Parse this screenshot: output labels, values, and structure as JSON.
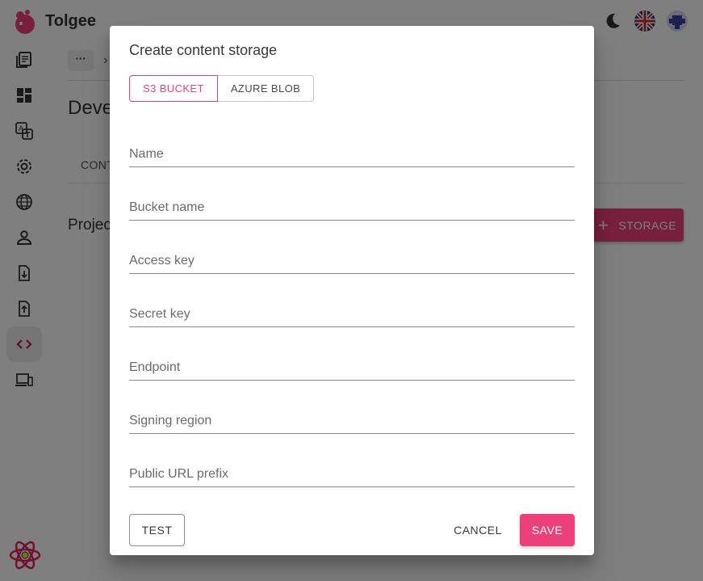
{
  "app": {
    "brand": "Tolgee"
  },
  "colors": {
    "accent": "#ec407a",
    "scrim": "rgba(0,0,0,0.5)"
  },
  "topbar": {
    "icons": [
      "theme-toggle-icon",
      "language-flag-icon",
      "user-avatar"
    ]
  },
  "sidebar": {
    "items": [
      {
        "icon": "projects-icon"
      },
      {
        "icon": "dashboard-icon"
      },
      {
        "icon": "translations-icon"
      },
      {
        "icon": "settings-icon"
      },
      {
        "icon": "languages-icon"
      },
      {
        "icon": "members-icon"
      },
      {
        "icon": "import-icon"
      },
      {
        "icon": "export-icon"
      },
      {
        "icon": "developer-icon",
        "active": true
      },
      {
        "icon": "integrate-icon"
      }
    ]
  },
  "background": {
    "breadcrumb_more": "···",
    "page_title": "Deve",
    "tab_label": "CONT",
    "section_heading": "Projec",
    "add_storage_label": "STORAGE"
  },
  "dialog": {
    "title": "Create content storage",
    "toggle": {
      "options": [
        "S3 BUCKET",
        "AZURE BLOB"
      ],
      "selected": "S3 BUCKET"
    },
    "fields": {
      "name": {
        "placeholder": "Name",
        "value": ""
      },
      "bucket_name": {
        "placeholder": "Bucket name",
        "value": ""
      },
      "access_key": {
        "placeholder": "Access key",
        "value": ""
      },
      "secret_key": {
        "placeholder": "Secret key",
        "value": ""
      },
      "endpoint": {
        "placeholder": "Endpoint",
        "value": ""
      },
      "signing_region": {
        "placeholder": "Signing region",
        "value": ""
      },
      "public_url_prefix": {
        "placeholder": "Public URL prefix",
        "value": ""
      }
    },
    "buttons": {
      "test": "TEST",
      "cancel": "CANCEL",
      "save": "SAVE"
    }
  }
}
